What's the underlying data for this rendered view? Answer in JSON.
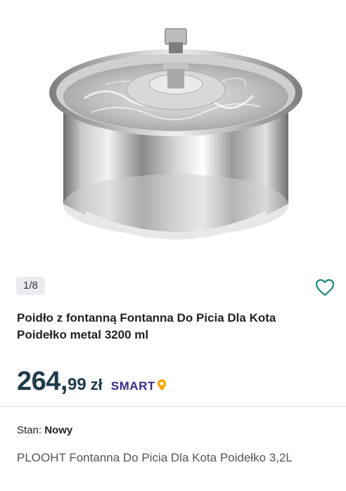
{
  "gallery": {
    "counter": "1/8"
  },
  "product": {
    "title": "Poidło z fontanną Fontanna Do Picia Dla Kota Poidełko metal 3200 ml",
    "price_int": "264,",
    "price_dec": "99",
    "currency": "zł",
    "smart_label": "SMART",
    "condition_label": "Stan:",
    "condition_value": "Nowy",
    "description": "PLOOHT Fontanna Do Picia Dla Kota Poidełko 3,2L"
  },
  "colors": {
    "price": "#1f3b4a",
    "smart": "#3b2a8f",
    "smart_pin": "#f7a600",
    "accent": "#1a8a7a"
  },
  "icons": {
    "favorite": "heart-outline-icon"
  }
}
